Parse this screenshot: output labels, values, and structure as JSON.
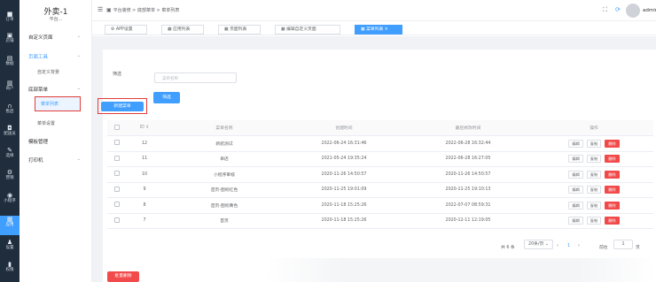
{
  "rail": [
    {
      "icon": "■",
      "label": "订单"
    },
    {
      "icon": "▣",
      "label": "店铺"
    },
    {
      "icon": "▤",
      "label": "数据"
    },
    {
      "icon": "▥",
      "label": "商户"
    },
    {
      "icon": "∩",
      "label": "售后"
    },
    {
      "icon": "◘",
      "label": "配送员"
    },
    {
      "icon": "✎",
      "label": "选择"
    },
    {
      "icon": "⚙",
      "label": "营销"
    },
    {
      "icon": "◉",
      "label": "小程序"
    },
    {
      "icon": "▦",
      "label": "应用"
    },
    {
      "icon": "♟",
      "label": "设置"
    },
    {
      "icon": "▮",
      "label": "权限"
    }
  ],
  "sidebar": {
    "store_name": "外卖-1",
    "store_sub": "平台...",
    "menu": [
      {
        "label": "自定义页面",
        "type": "group"
      },
      {
        "label": "页面工具",
        "type": "group"
      },
      {
        "label": "自定义背景",
        "type": "sub"
      },
      {
        "label": "底部菜单",
        "type": "group"
      },
      {
        "label": "菜单列表",
        "type": "active"
      },
      {
        "label": "菜单设置",
        "type": "sub"
      },
      {
        "label": "模板管理",
        "type": "plain"
      },
      {
        "label": "打印机",
        "type": "group"
      }
    ]
  },
  "topbar": {
    "breadcrumb": "平台装修 > 底部菜单 > 菜单列表",
    "user": "admin"
  },
  "tabs": [
    "APP设置",
    "应用列表",
    "页面列表",
    "编辑自定义页面",
    "菜单列表"
  ],
  "filter": {
    "label": "筛选",
    "placeholder": "菜单名称",
    "button": "筛选"
  },
  "new_button": "新建菜单",
  "table": {
    "headers": [
      "",
      "ID",
      "菜单名称",
      "创建时间",
      "最后修改时间",
      "操作"
    ],
    "actions": {
      "edit": "编辑",
      "copy": "复制",
      "delete": "删除"
    },
    "rows": [
      {
        "id": "12",
        "name": "新航测试",
        "created": "2022-06-24 16:31:46",
        "modified": "2022-06-28 16:32:44"
      },
      {
        "id": "11",
        "name": "单店",
        "created": "2021-05-24 19:35:24",
        "modified": "2022-06-28 16:27:05"
      },
      {
        "id": "10",
        "name": "小程序审核",
        "created": "2020-11-26 14:50:57",
        "modified": "2020-11-26 14:50:57"
      },
      {
        "id": "9",
        "name": "首页-图标红色",
        "created": "2020-11-25 19:01:09",
        "modified": "2020-11-25 19:10:13"
      },
      {
        "id": "8",
        "name": "首页-图标黄色",
        "created": "2020-11-18 15:25:26",
        "modified": "2022-07-07 08:59:31"
      },
      {
        "id": "7",
        "name": "首页",
        "created": "2020-11-18 15:25:26",
        "modified": "2020-12-11 12:19:05"
      }
    ]
  },
  "batch_delete": "批量删除",
  "pagination": {
    "total": "共 6 条",
    "page_size": "20条/页",
    "current_page": "1",
    "goto_label": "前往",
    "goto_value": "1",
    "goto_suffix": "页"
  },
  "colors": {
    "primary": "#409eff",
    "danger": "#f24a4a",
    "rail": "#1f2d3d",
    "highlight_box": "#e23b3b"
  }
}
